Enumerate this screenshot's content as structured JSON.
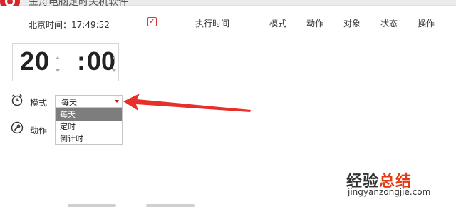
{
  "window": {
    "title": "金舟电脑定时关机软件"
  },
  "clock": {
    "label": "北京时间：17:49:52"
  },
  "time_input": {
    "hour": "20",
    "separator": ":",
    "minute": "00"
  },
  "mode": {
    "label": "模式",
    "selected": "每天",
    "options": [
      "每天",
      "定时",
      "倒计时"
    ]
  },
  "action": {
    "label": "动作"
  },
  "task_table": {
    "columns": [
      "执行时间",
      "模式",
      "动作",
      "对象",
      "状态",
      "操作"
    ],
    "select_all_glyph": "✓"
  },
  "watermark": {
    "title_part1": "经验",
    "title_part2": "总结",
    "url": "jingyanzongjie.com"
  },
  "colors": {
    "accent": "#d23b3b",
    "arrow": "#e8302a",
    "selected_option": "#7d7d7d"
  },
  "icons": {
    "app": "app-logo-icon",
    "mode": "alarm-clock-icon",
    "action": "wrench-icon",
    "dropdown": "chevron-down-icon"
  }
}
